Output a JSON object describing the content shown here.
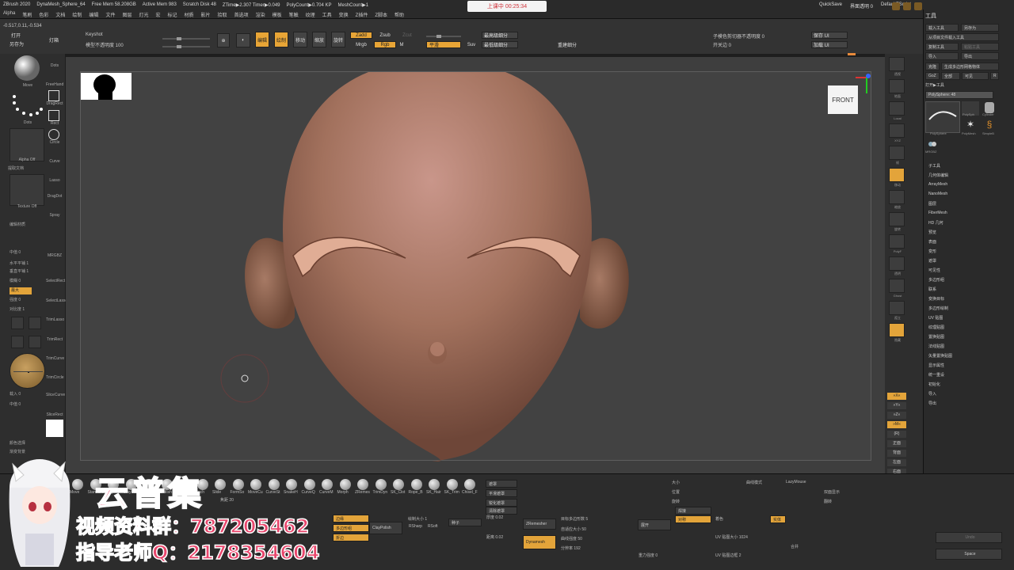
{
  "status": {
    "app": "ZBrush 2020",
    "doc": "DynaMesh_Sphere_64",
    "free_mem": "Free Mem 58.208GB",
    "active_mem": "Active Mem 983",
    "scratch": "Scratch Disk 48",
    "ztime": "ZTime▶2.307 Timer▶0.049",
    "polycount": "PolyCount▶0.704 KP",
    "meshcount": "MeshCount▶1",
    "recording": "上课中 00:25:34",
    "quicksave": "QuickSave",
    "transparency": "界面透明 0",
    "script": "DefaultZScript"
  },
  "menus": [
    "Alpha",
    "笔刷",
    "色彩",
    "文档",
    "绘制",
    "编辑",
    "文件",
    "图层",
    "灯光",
    "宏",
    "标记",
    "材质",
    "影片",
    "拾取",
    "首选项",
    "渲染",
    "模板",
    "笔触",
    "纹理",
    "工具",
    "变换",
    "Z插件",
    "Z脚本",
    "帮助"
  ],
  "coords": "-0.517,0.11,-0.534",
  "toolbar": {
    "open": "打开",
    "save_as": "另存为",
    "light": "灯箱",
    "keyshot": "Keyshot",
    "keyshot_opacity": "模型不透明度 100",
    "edit": "编辑",
    "draw": "绘制",
    "move": "移动",
    "scale": "缩放",
    "rotate": "旋转",
    "zadd": "Zadd",
    "zsub": "Zsub",
    "zcut": "Zcut",
    "mrgb": "Mrgb",
    "rgb": "Rgb",
    "m": "M",
    "smooth_label": "平滑",
    "suv": "Suv",
    "subdiv_high": "最高级细分",
    "subdiv_low": "最低级细分",
    "rebuild": "重建细分",
    "subtool_opacity": "子模色剪切器不透明度 0",
    "edge_loop": "开关边 0",
    "save_ui": "保存 UI",
    "load_ui": "加载 UI"
  },
  "left": {
    "move": "Move",
    "dots": "Dots",
    "freehand": "FreeHand",
    "dragrect": "DragRect",
    "rect": "Rect",
    "circle": "Circle",
    "curve": "Curve",
    "lasso": "Lasso",
    "dragdot": "DragDot",
    "spray": "Spray",
    "alpha_off": "Alpha Off",
    "extract": "提取文档",
    "texture_off": "Texture Off",
    "mrgbz": "MRGBZ",
    "selectrect": "SelectRect",
    "selectlasso": "SelectLasso",
    "trimlasso": "TrimLasso",
    "trimrect": "TrimRect",
    "trimcurve": "TrimCurve",
    "trimcircle": "TrimCircle",
    "slicecurve": "SliceCurve",
    "slicerect": "SliceRect",
    "symmetry": "水平平铺 1",
    "v_tile": "垂直平铺 1",
    "mode": "模糊 0",
    "max": "最大",
    "intensity": "强度 0",
    "contrast": "对比度 1",
    "import": "载入 0",
    "mid": "中值 0",
    "color_label": "颜色选择",
    "bg": "渐变背景",
    "edit_material": "编辑材质"
  },
  "viewport": {
    "front_label": "FRONT"
  },
  "right_tray": [
    "透视",
    "地面",
    "Local",
    "XYZ",
    "帧",
    "移动",
    "缩放",
    "旋转",
    "PolyF",
    "透明",
    "Ghost",
    "孤立",
    "隐藏"
  ],
  "tool_panel": {
    "title": "工具",
    "buttons": [
      "载入工具",
      "另存为",
      "从项目文件载入工具",
      "复制工具",
      "粘贴工具",
      "导入",
      "导出",
      "克隆",
      "生成多边形网格物体",
      "GoZ",
      "全部",
      "可见",
      "R"
    ],
    "tool_name": "打开▶工具",
    "polysphere": "PolySphere: 48",
    "thumbs": [
      "PolySphere",
      "PolySph",
      "Cylinder",
      "PolyMesh",
      "SimpleB",
      "MRGBZ"
    ],
    "subtools": [
      "子工具",
      "几何体编辑",
      "ArrayMesh",
      "NanoMesh",
      "图层",
      "FiberMesh",
      "HD 几何",
      "预览",
      "表面",
      "变形",
      "遮罩",
      "可见性",
      "多边形组",
      "联系",
      "变换目标",
      "多边形绘制",
      "UV 贴图",
      "纹理贴图",
      "置换贴图",
      "法线贴图",
      "矢量置换贴图",
      "显示属性",
      "统一重设",
      "初始化",
      "导入",
      "导出"
    ]
  },
  "right_strip": [
    "»X«",
    "»Y«",
    "»Z«",
    "»M«",
    "(R)",
    "正面",
    "背面",
    "左面",
    "右面",
    "上面",
    "下面",
    "Cust1"
  ],
  "bottom": {
    "brushes": [
      "Move",
      "Standard",
      "Clay",
      "ClayBuildup",
      "DamStandard",
      "hPolish",
      "Inflat",
      "Pinch",
      "Slide",
      "FormSo",
      "MoveCu",
      "CurveSt",
      "SnakeH",
      "CurveQ",
      "CurveM",
      "Morph",
      "ZRemes",
      "TrimDyn",
      "SK_Clot",
      "Rope_B",
      "SK_Hair",
      "SK_Trim",
      "Chisel_F"
    ],
    "polish": "ClayPolish",
    "sharp": "RSharp",
    "rsoft": "RSoft",
    "zremesher": "ZRemesher",
    "dynamesh": "Dynamesh",
    "edge_loop": "边缘",
    "poly_loop": "多边形组",
    "fold": "折边",
    "target": "目标多边形数 5",
    "adaptive": "自适应大小 50",
    "smooth_groups": "曲线强度 50",
    "resolution": "分辨率 192",
    "projection": "投射",
    "shadow": "厚度 0.02",
    "density": "距离 0.02",
    "mask": "遮罩",
    "flat": "平滑遮罩",
    "crop": "锐化遮罩",
    "clear": "清除遮罩",
    "invert": "反向遮罩",
    "scale": "大小",
    "position": "位置",
    "rotation": "旋转",
    "mirror": "对称",
    "weld": "焊接",
    "color": "着色",
    "double": "双面显示",
    "uv_map": "UV 贴图大小 1024",
    "uv_border": "UV 贴图边框 2",
    "lazymouse": "LazyMouse",
    "lazystep": "曲线模式",
    "flip": "翻转",
    "space": "Space",
    "undo": "Undo",
    "gravity": "重力强度 0",
    "focal": "焦距 20",
    "draw_size": "绘制大小 1",
    "solid": "实体",
    "seed": "种子",
    "expand": "展开",
    "merge": "合并"
  },
  "watermark": {
    "title": "云普集",
    "line1": "视频资料群：787205462",
    "line2": "指导老师Q：2178354604"
  }
}
